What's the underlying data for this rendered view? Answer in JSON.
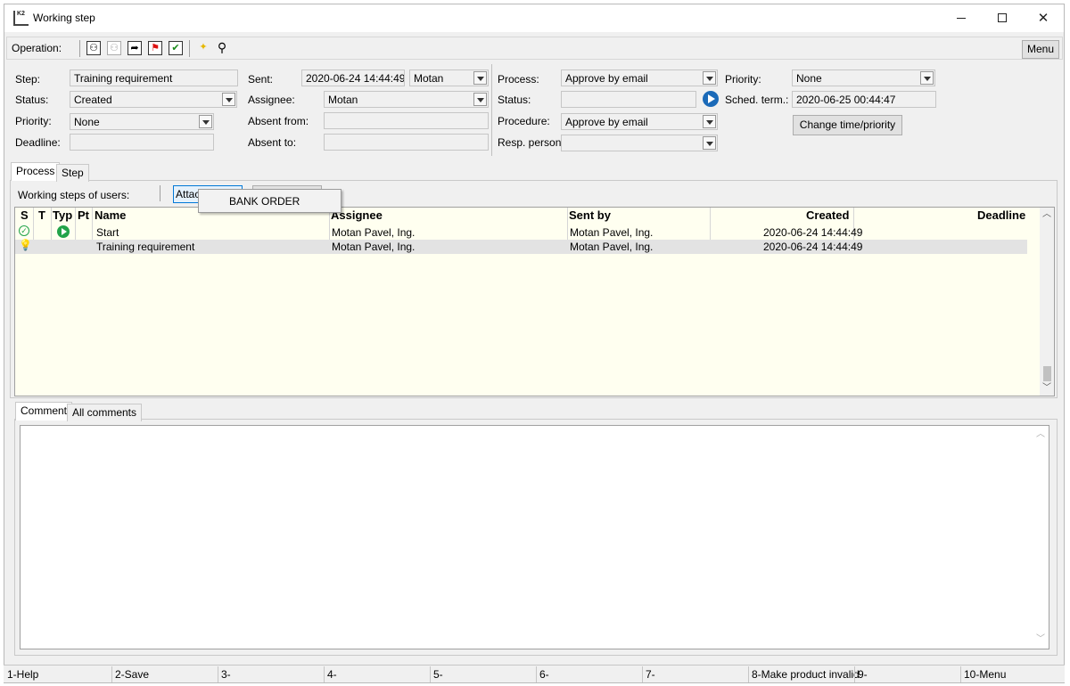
{
  "window": {
    "title": "Working step",
    "icon_text": "K2"
  },
  "toolbar": {
    "operation_label": "Operation:",
    "menu_label": "Menu"
  },
  "form": {
    "step_label": "Step:",
    "step_value": "Training requirement",
    "status_label": "Status:",
    "status_value": "Created",
    "priority_label": "Priority:",
    "priority_value": "None",
    "deadline_label": "Deadline:",
    "deadline_value": "",
    "sent_label": "Sent:",
    "sent_value": "2020-06-24 14:44:49",
    "sent_user": "Motan",
    "assignee_label": "Assignee:",
    "assignee_value": "Motan",
    "absent_from_label": "Absent from:",
    "absent_from_value": "",
    "absent_to_label": "Absent to:",
    "absent_to_value": "",
    "process_label": "Process:",
    "process_value": "Approve by email",
    "process_status_label": "Status:",
    "process_status_value": "",
    "procedure_label": "Procedure:",
    "procedure_value": "Approve by email",
    "resp_person_label": "Resp. person:",
    "resp_person_value": "",
    "process_priority_label": "Priority:",
    "process_priority_value": "None",
    "sched_term_label": "Sched. term.:",
    "sched_term_value": "2020-06-25 00:44:47",
    "change_button": "Change time/priority"
  },
  "tabs_top": [
    {
      "label": "Process"
    },
    {
      "label": "Step"
    }
  ],
  "process_tab": {
    "working_steps_label": "Working steps of users:",
    "attach_button_partial": "Attac",
    "popup_item": "BANK ORDER"
  },
  "grid": {
    "columns": [
      "S",
      "T",
      "Typ",
      "Pt",
      "Name",
      "Assignee",
      "Sent by",
      "Created",
      "Deadline"
    ],
    "rows": [
      {
        "name": "Start",
        "assignee": "Motan Pavel, Ing.",
        "sent_by": "Motan Pavel, Ing.",
        "created": "2020-06-24 14:44:49",
        "deadline": ""
      },
      {
        "name": "Training requirement",
        "assignee": "Motan Pavel, Ing.",
        "sent_by": "Motan Pavel, Ing.",
        "created": "2020-06-24 14:44:49",
        "deadline": ""
      }
    ]
  },
  "tabs_bottom": [
    {
      "label": "Comment"
    },
    {
      "label": "All comments"
    }
  ],
  "statusbar": {
    "keys": [
      "1-Help",
      "2-Save",
      "3-",
      "4-",
      "5-",
      "6-",
      "7-",
      "8-Make product invalid",
      "9-",
      "10-Menu"
    ]
  },
  "colors": {
    "grid_background": "#fffff0",
    "selected_row": "#e3e3e3",
    "accent_blue": "#1b6ab8",
    "ok_green": "#22a34a"
  }
}
